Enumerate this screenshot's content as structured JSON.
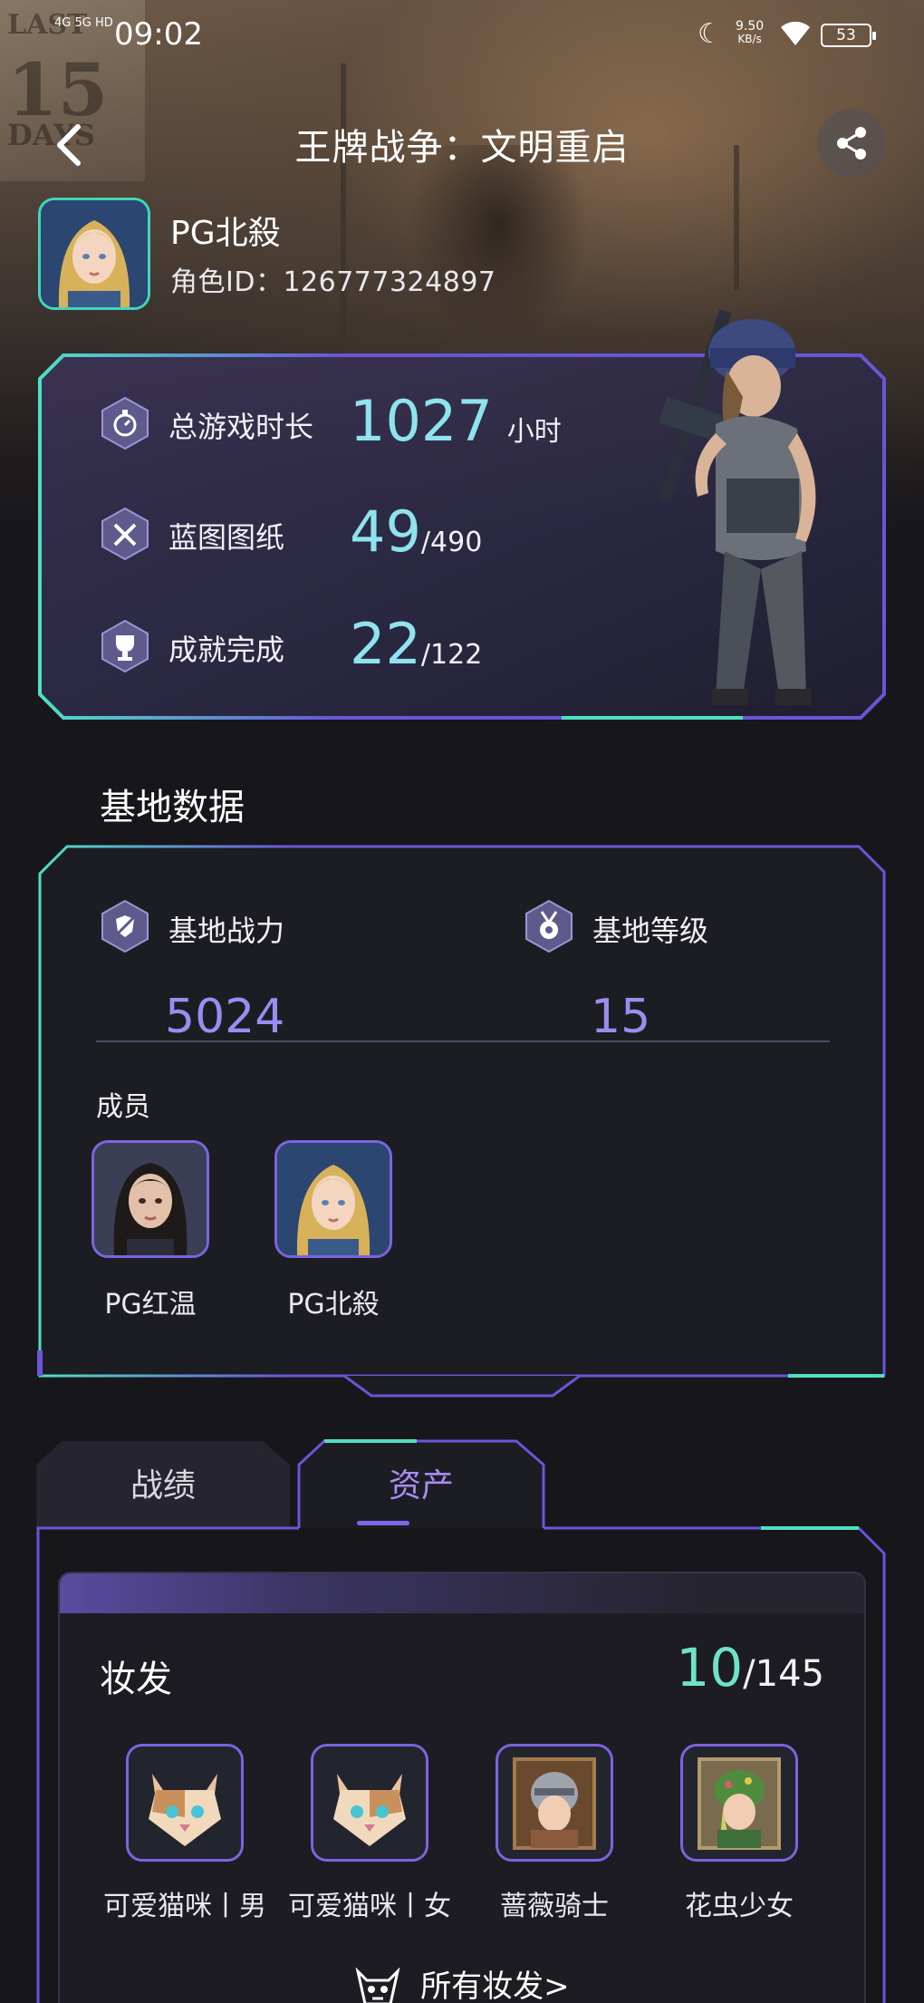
{
  "status_bar": {
    "carrier": "4G 5G HD",
    "time": "09:02",
    "net_speed_value": "9.50",
    "net_speed_unit": "KB/s",
    "battery": "53"
  },
  "header": {
    "title": "王牌战争：文明重启",
    "back_icon": "chevron-left-icon",
    "share_icon": "share-icon"
  },
  "background_sign": {
    "line1": "LAST",
    "line2": "15",
    "line3": "DAYS"
  },
  "profile": {
    "name": "PG北殺",
    "role_id": "角色ID：126777324897"
  },
  "stats": [
    {
      "label": "总游戏时长",
      "value": "1027",
      "suffix": "",
      "unit": "小时",
      "icon": "stopwatch-icon"
    },
    {
      "label": "蓝图图纸",
      "value": "49",
      "suffix": "/490",
      "unit": "",
      "icon": "blueprint-icon"
    },
    {
      "label": "成就完成",
      "value": "22",
      "suffix": "/122",
      "unit": "",
      "icon": "trophy-icon"
    }
  ],
  "base": {
    "section_title": "基地数据",
    "power_label": "基地战力",
    "power_value": "5024",
    "level_label": "基地等级",
    "level_value": "15",
    "members_label": "成员",
    "members": [
      {
        "name": "PG红温"
      },
      {
        "name": "PG北殺"
      }
    ]
  },
  "tabs": {
    "items": [
      {
        "label": "战绩",
        "active": false
      },
      {
        "label": "资产",
        "active": true
      }
    ]
  },
  "assets": {
    "title": "妆发",
    "count": "10",
    "total": "/145",
    "skins": [
      {
        "name": "可爱猫咪丨男"
      },
      {
        "name": "可爱猫咪丨女"
      },
      {
        "name": "蔷薇骑士"
      },
      {
        "name": "花虫少女"
      }
    ],
    "all_link": "所有妆发>"
  },
  "colors": {
    "accent_purple": "#7f66e8",
    "accent_teal": "#3fd7b8",
    "value_cyan": "#8fe3ef",
    "background": "#16161b"
  }
}
